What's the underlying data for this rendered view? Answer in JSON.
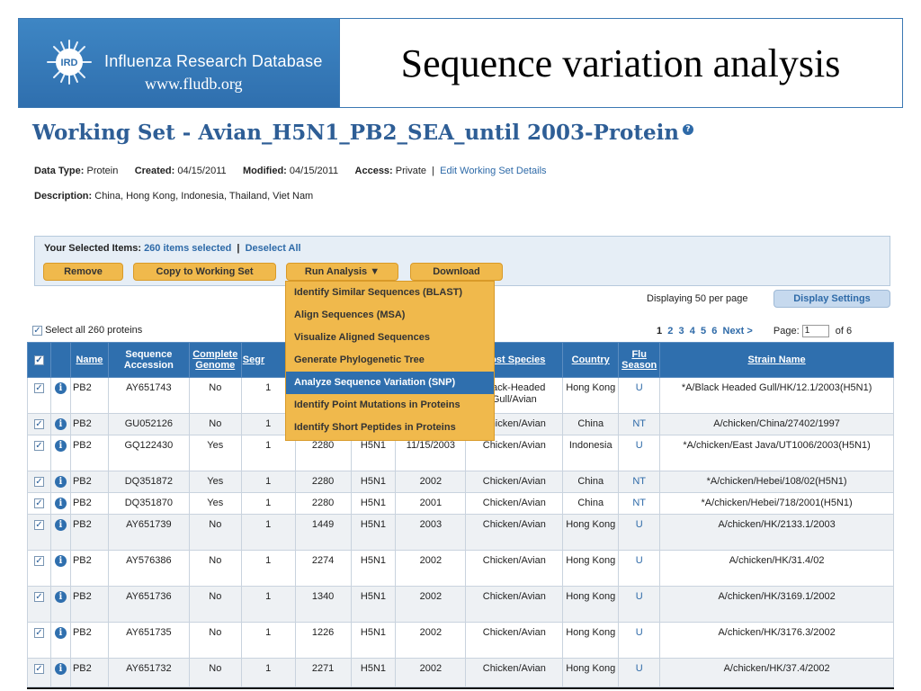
{
  "banner": {
    "logo_text": "IRD",
    "name": "Influenza Research Database",
    "url": "www.fludb.org",
    "slide_title": "Sequence variation analysis"
  },
  "working_set": {
    "title": "Working Set - Avian_H5N1_PB2_SEA_until 2003-Protein",
    "data_type_label": "Data Type:",
    "data_type": "Protein",
    "created_label": "Created:",
    "created": "04/15/2011",
    "modified_label": "Modified:",
    "modified": "04/15/2011",
    "access_label": "Access:",
    "access": "Private",
    "edit_link": "Edit Working Set Details",
    "description_label": "Description:",
    "description": "China, Hong Kong, Indonesia, Thailand, Viet Nam"
  },
  "selection": {
    "label": "Your Selected Items:",
    "count": "260 items selected",
    "deselect": "Deselect All",
    "buttons": {
      "remove": "Remove",
      "copy": "Copy to Working Set",
      "run": "Run Analysis ▼",
      "download": "Download"
    }
  },
  "menu": {
    "items": [
      "Identify Similar Sequences (BLAST)",
      "Align Sequences (MSA)",
      "Visualize Aligned Sequences",
      "Generate Phylogenetic Tree",
      "Analyze Sequence Variation (SNP)",
      "Identify Point Mutations in Proteins",
      "Identify Short Peptides in Proteins"
    ],
    "active_index": 4
  },
  "display": {
    "displaying": "Displaying 50 per page",
    "settings_button": "Display Settings",
    "select_all": "Select all 260 proteins",
    "pages": [
      "1",
      "2",
      "3",
      "4",
      "5",
      "6"
    ],
    "next": "Next >",
    "page_label": "Page:",
    "page_value": "1",
    "of_label": "of 6"
  },
  "table": {
    "headers": {
      "name": "Name",
      "accession": "Sequence Accession",
      "complete": "Complete Genome",
      "segment": "Segr",
      "host": "Host Species",
      "country": "Country",
      "flu_season": "Flu Season",
      "strain": "Strain Name"
    },
    "rows": [
      {
        "name": "PB2",
        "acc": "AY651743",
        "complete": "No",
        "seg": "1",
        "len": "",
        "sub": "",
        "date": "",
        "host": "Black-Headed Gull/Avian",
        "country": "Hong Kong",
        "season": "U",
        "strain": "*A/Black Headed Gull/HK/12.1/2003(H5N1)"
      },
      {
        "name": "PB2",
        "acc": "GU052126",
        "complete": "No",
        "seg": "1",
        "len": "",
        "sub": "",
        "date": "",
        "host": "Chicken/Avian",
        "country": "China",
        "season": "NT",
        "strain": "A/chicken/China/27402/1997"
      },
      {
        "name": "PB2",
        "acc": "GQ122430",
        "complete": "Yes",
        "seg": "1",
        "len": "2280",
        "sub": "H5N1",
        "date": "11/15/2003",
        "host": "Chicken/Avian",
        "country": "Indonesia",
        "season": "U",
        "strain": "*A/chicken/East Java/UT1006/2003(H5N1)"
      },
      {
        "name": "PB2",
        "acc": "DQ351872",
        "complete": "Yes",
        "seg": "1",
        "len": "2280",
        "sub": "H5N1",
        "date": "2002",
        "host": "Chicken/Avian",
        "country": "China",
        "season": "NT",
        "strain": "*A/chicken/Hebei/108/02(H5N1)"
      },
      {
        "name": "PB2",
        "acc": "DQ351870",
        "complete": "Yes",
        "seg": "1",
        "len": "2280",
        "sub": "H5N1",
        "date": "2001",
        "host": "Chicken/Avian",
        "country": "China",
        "season": "NT",
        "strain": "*A/chicken/Hebei/718/2001(H5N1)"
      },
      {
        "name": "PB2",
        "acc": "AY651739",
        "complete": "No",
        "seg": "1",
        "len": "1449",
        "sub": "H5N1",
        "date": "2003",
        "host": "Chicken/Avian",
        "country": "Hong Kong",
        "season": "U",
        "strain": "A/chicken/HK/2133.1/2003"
      },
      {
        "name": "PB2",
        "acc": "AY576386",
        "complete": "No",
        "seg": "1",
        "len": "2274",
        "sub": "H5N1",
        "date": "2002",
        "host": "Chicken/Avian",
        "country": "Hong Kong",
        "season": "U",
        "strain": "A/chicken/HK/31.4/02"
      },
      {
        "name": "PB2",
        "acc": "AY651736",
        "complete": "No",
        "seg": "1",
        "len": "1340",
        "sub": "H5N1",
        "date": "2002",
        "host": "Chicken/Avian",
        "country": "Hong Kong",
        "season": "U",
        "strain": "A/chicken/HK/3169.1/2002"
      },
      {
        "name": "PB2",
        "acc": "AY651735",
        "complete": "No",
        "seg": "1",
        "len": "1226",
        "sub": "H5N1",
        "date": "2002",
        "host": "Chicken/Avian",
        "country": "Hong Kong",
        "season": "U",
        "strain": "A/chicken/HK/3176.3/2002"
      },
      {
        "name": "PB2",
        "acc": "AY651732",
        "complete": "No",
        "seg": "1",
        "len": "2271",
        "sub": "H5N1",
        "date": "2002",
        "host": "Chicken/Avian",
        "country": "Hong Kong",
        "season": "U",
        "strain": "A/chicken/HK/37.4/2002"
      }
    ]
  }
}
